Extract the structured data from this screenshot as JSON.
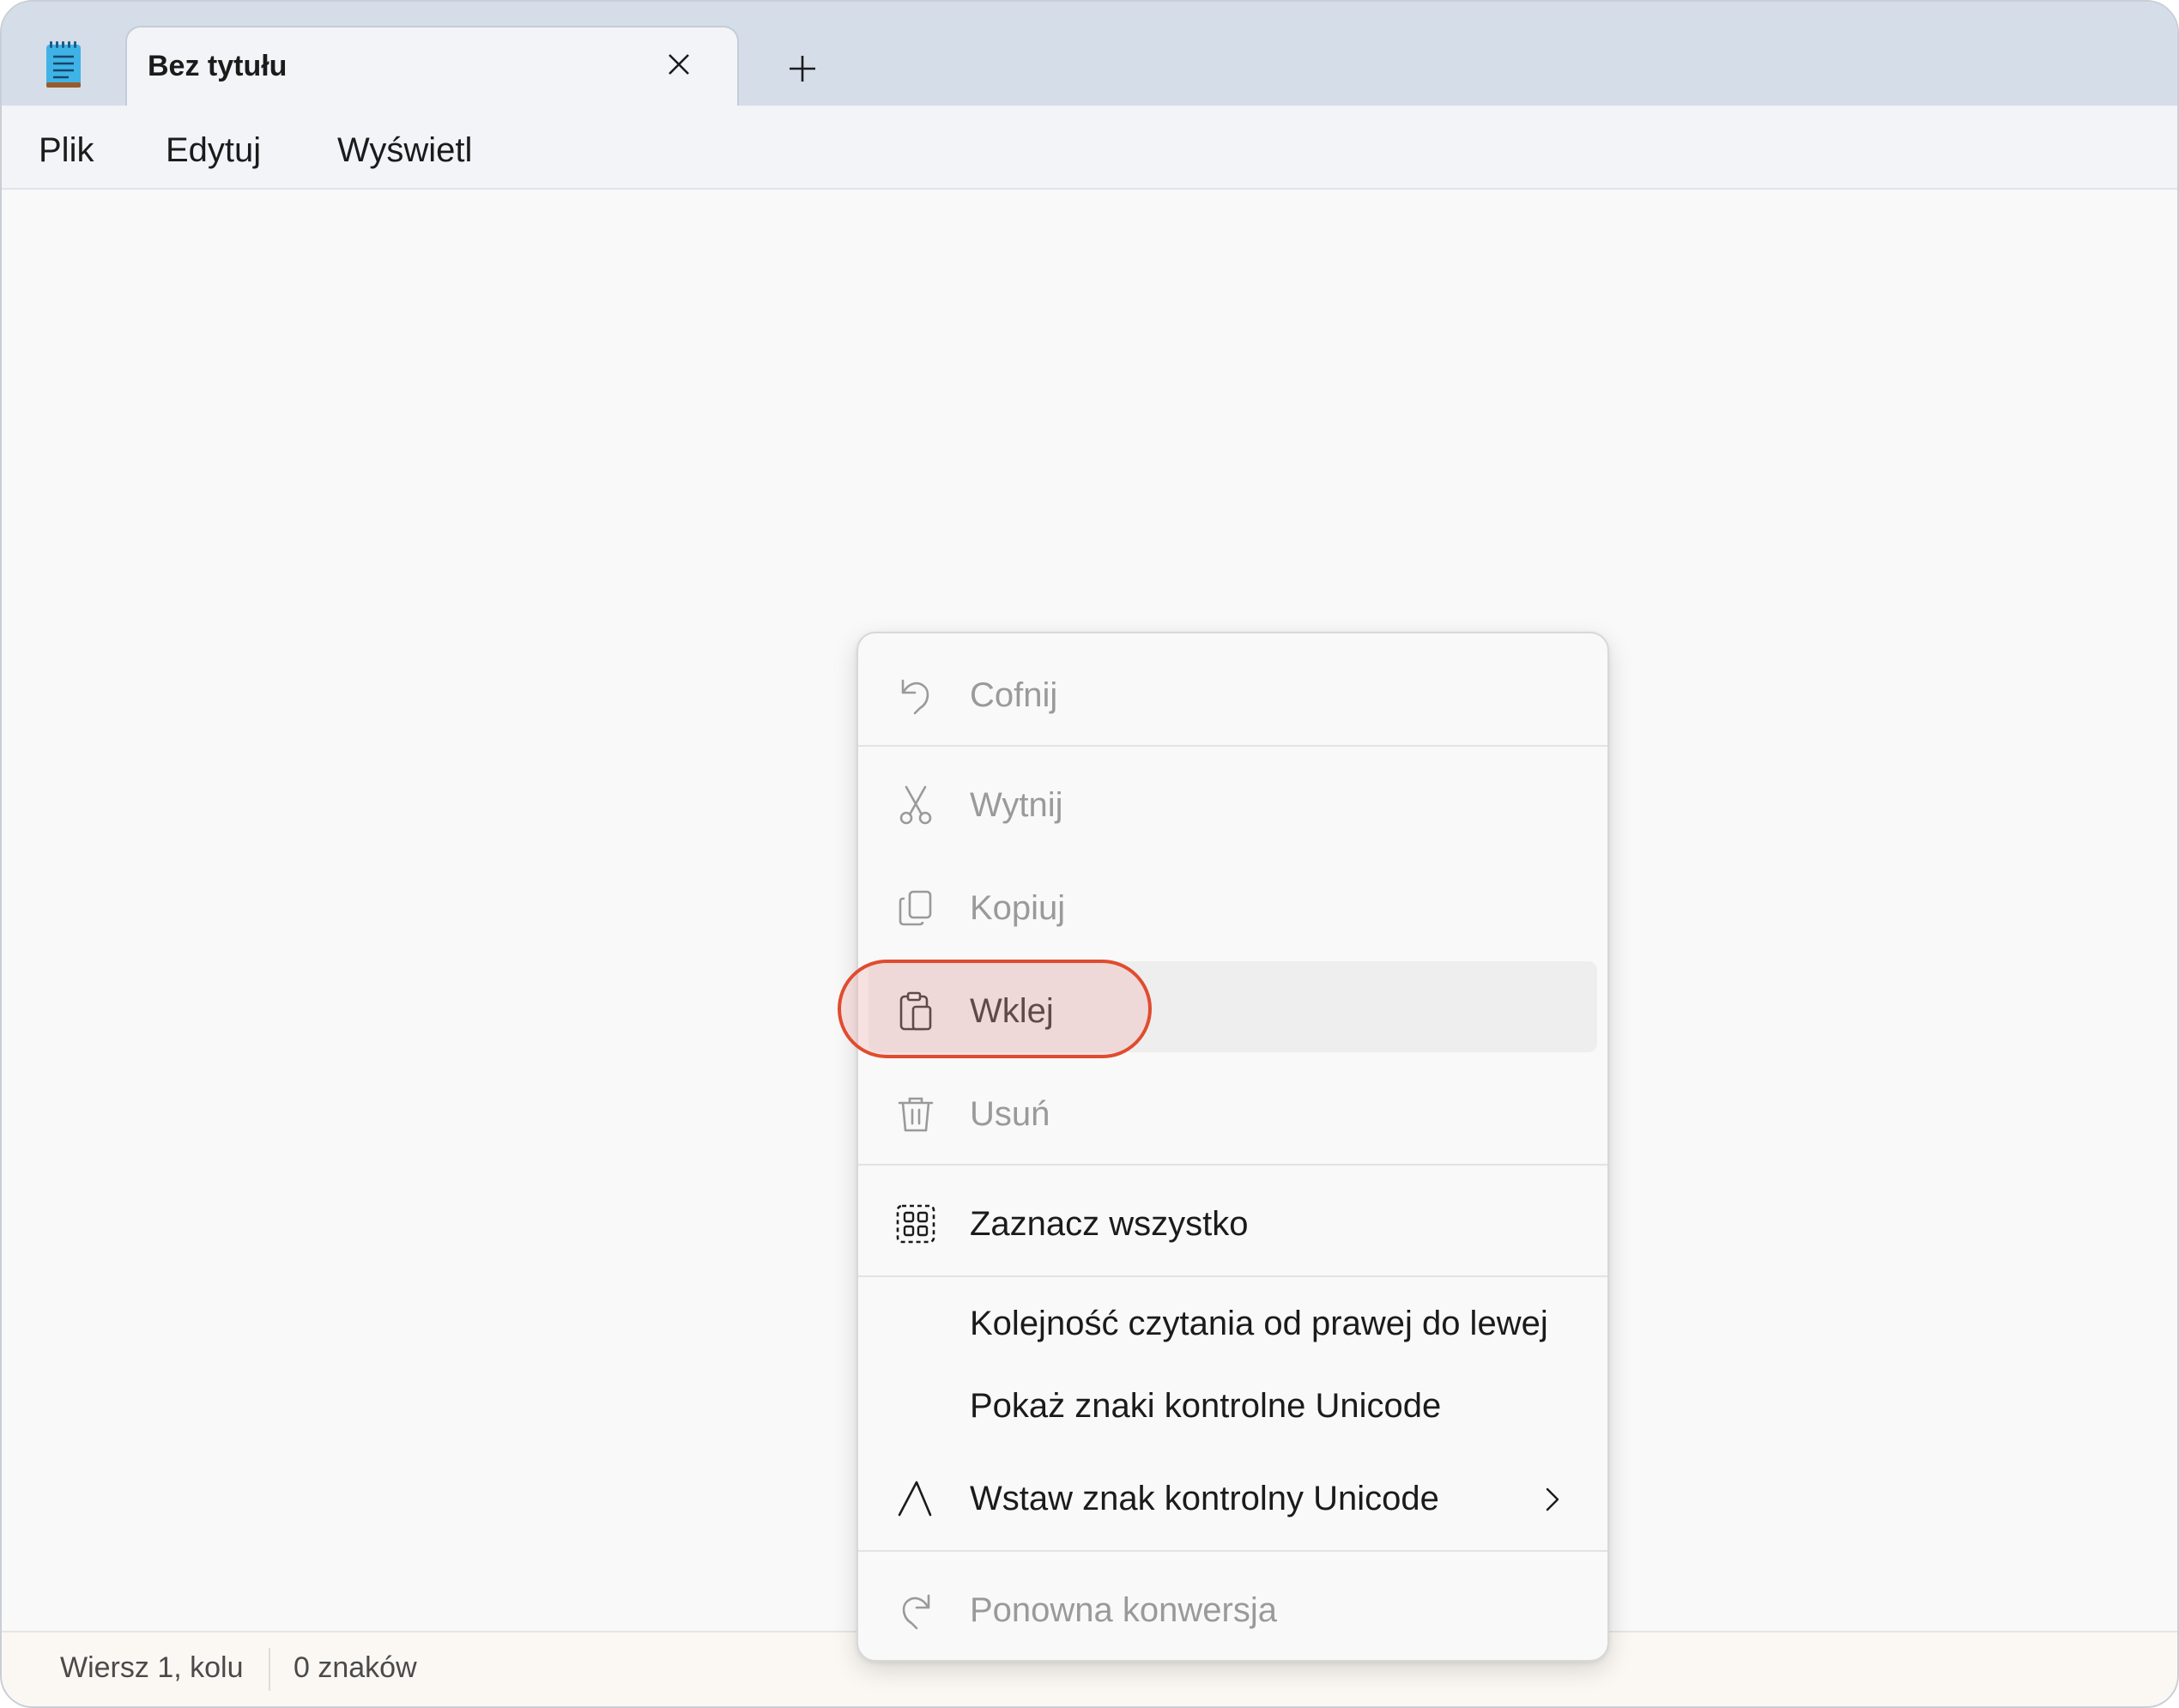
{
  "titlebar": {
    "app_icon": "notepad-icon",
    "tab_title": "Bez tytułu",
    "tab_close_icon": "close-icon",
    "new_tab_icon": "plus-icon"
  },
  "menubar": {
    "items": [
      "Plik",
      "Edytuj",
      "Wyświetl"
    ]
  },
  "context_menu": {
    "items": [
      {
        "label": "Cofnij",
        "icon": "undo-icon",
        "enabled": false
      },
      {
        "label": "Wytnij",
        "icon": "scissors-icon",
        "enabled": false
      },
      {
        "label": "Kopiuj",
        "icon": "copy-icon",
        "enabled": false
      },
      {
        "label": "Wklej",
        "icon": "paste-icon",
        "enabled": true,
        "highlighted": true
      },
      {
        "label": "Usuń",
        "icon": "trash-icon",
        "enabled": false
      },
      {
        "label": "Zaznacz wszystko",
        "icon": "select-all-icon",
        "enabled": true
      },
      {
        "label": "Kolejność czytania od prawej do lewej",
        "enabled": true
      },
      {
        "label": "Pokaż znaki kontrolne Unicode",
        "enabled": true
      },
      {
        "label": "Wstaw znak kontrolny Unicode",
        "icon": "caret-icon",
        "enabled": true,
        "submenu": "chevron-right-icon"
      },
      {
        "label": "Ponowna konwersja",
        "icon": "reconvert-icon",
        "enabled": false
      }
    ]
  },
  "statusbar": {
    "position": "Wiersz 1, kolu",
    "char_count": "0 znaków"
  },
  "colors": {
    "titlebar_bg": "#d5dde9",
    "highlight_ring": "#e04c2e",
    "disabled_text": "#9a9a9a"
  }
}
